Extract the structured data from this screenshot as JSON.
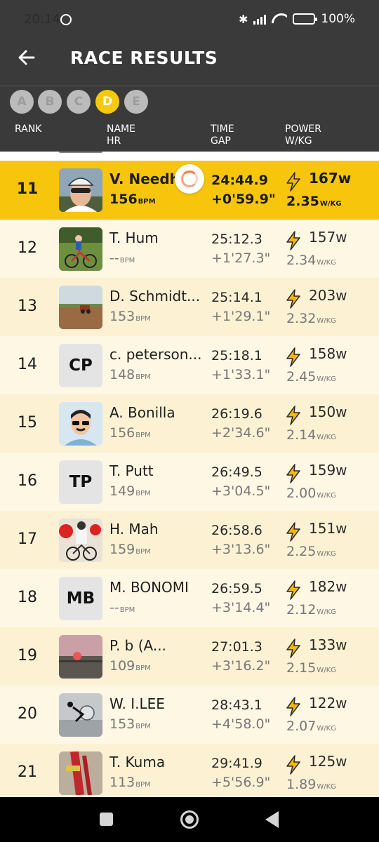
{
  "status_bar": {
    "time": "20:14",
    "battery": "100%"
  },
  "app_bar": {
    "title": "RACE RESULTS"
  },
  "categories": [
    "A",
    "B",
    "C",
    "D",
    "E"
  ],
  "selected_category": "D",
  "columns": {
    "rank": "RANK",
    "name": "NAME",
    "hr": "HR",
    "time": "TIME",
    "gap": "GAP",
    "power": "POWER",
    "wkg": "W/KG"
  },
  "units": {
    "bpm": "BPM",
    "wkg": "W/KG"
  },
  "rows": [
    {
      "rank": "11",
      "name": "V. Needh",
      "hr": "156",
      "time": "24:44.9",
      "gap": "+0'59.9\"",
      "watts": "167w",
      "wkg": "2.35",
      "avatar": "photo-cyclist-helmet",
      "highlighted": true
    },
    {
      "rank": "12",
      "name": "T. Hum",
      "hr": "--",
      "time": "25:12.3",
      "gap": "+1'27.3\"",
      "watts": "157w",
      "wkg": "2.34",
      "avatar": "photo-child-bike"
    },
    {
      "rank": "13",
      "name": "D. Schmidt...",
      "hr": "153",
      "time": "25:14.1",
      "gap": "+1'29.1\"",
      "watts": "203w",
      "wkg": "2.32",
      "avatar": "photo-field-tractor"
    },
    {
      "rank": "14",
      "name": "c. peterson...",
      "hr": "148",
      "time": "25:18.1",
      "gap": "+1'33.1\"",
      "watts": "158w",
      "wkg": "2.45",
      "avatar_initials": "CP"
    },
    {
      "rank": "15",
      "name": "A. Bonilla",
      "hr": "156",
      "time": "26:19.6",
      "gap": "+2'34.6\"",
      "watts": "150w",
      "wkg": "2.14",
      "avatar": "cartoon-man-sunglasses"
    },
    {
      "rank": "16",
      "name": "T. Putt",
      "hr": "149",
      "time": "26:49.5",
      "gap": "+3'04.5\"",
      "watts": "159w",
      "wkg": "2.00",
      "avatar_initials": "TP"
    },
    {
      "rank": "17",
      "name": "H. Mah",
      "hr": "159",
      "time": "26:58.6",
      "gap": "+3'13.6\"",
      "watts": "151w",
      "wkg": "2.25",
      "avatar": "photo-race-cyclist"
    },
    {
      "rank": "18",
      "name": "M. BONOMI",
      "hr": "--",
      "time": "26:59.5",
      "gap": "+3'14.4\"",
      "watts": "182w",
      "wkg": "2.12",
      "avatar_initials": "MB"
    },
    {
      "rank": "19",
      "name": "P. b (A...",
      "hr": "109",
      "time": "27:01.3",
      "gap": "+3'16.2\"",
      "watts": "133w",
      "wkg": "2.15",
      "avatar": "photo-sunset"
    },
    {
      "rank": "20",
      "name": "W. I.LEE",
      "hr": "153",
      "time": "28:43.1",
      "gap": "+4'58.0\"",
      "watts": "122w",
      "wkg": "2.07",
      "avatar": "photo-car-decal"
    },
    {
      "rank": "21",
      "name": "T. Kuma",
      "hr": "113",
      "time": "29:41.9",
      "gap": "+5'56.9\"",
      "watts": "125w",
      "wkg": "1.89",
      "avatar": "photo-red-bike"
    }
  ],
  "colors": {
    "header_bg": "#3a3a3a",
    "highlight": "#f7c50b",
    "row_light": "#fdf7e4",
    "row_dark": "#fcf1d3",
    "bolt": "#f3b80f"
  },
  "icons": {
    "back": "arrow-left-icon",
    "power": "lightning-bolt-icon",
    "loading": "loading-spinner-icon"
  }
}
